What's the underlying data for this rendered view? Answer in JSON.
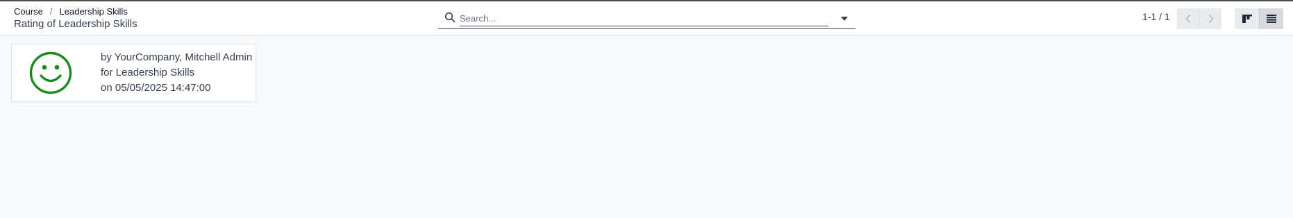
{
  "breadcrumb": {
    "parent": "Course",
    "separator": "/",
    "current": "Leadership Skills"
  },
  "page_title": "Rating of Leadership Skills",
  "search": {
    "placeholder": "Search...",
    "value": "",
    "icon": "magnifier-icon",
    "toggle_icon": "caret-down-icon"
  },
  "pager": {
    "value": "1-1 / 1",
    "previous_icon": "chevron-left-icon",
    "next_icon": "chevron-right-icon"
  },
  "view_switcher": {
    "kanban_icon": "kanban-icon",
    "list_icon": "list-icon",
    "active": "list"
  },
  "ratings": [
    {
      "icon": "smiley-icon",
      "by": "by YourCompany, Mitchell Admin",
      "for": "for Leadership Skills",
      "on": "on 05/05/2025 14:47:00"
    }
  ],
  "colors": {
    "satisfied": "#1a8a1a",
    "background": "#f8f9fa",
    "panel": "#ffffff"
  }
}
